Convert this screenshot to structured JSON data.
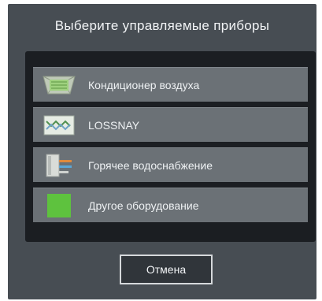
{
  "dialog": {
    "title": "Выберите управляемые приборы",
    "items": [
      {
        "label": "Кондиционер воздуха",
        "icon": "air-conditioner-icon"
      },
      {
        "label": "LOSSNAY",
        "icon": "lossnay-ventilation-icon"
      },
      {
        "label": "Горячее водоснабжение",
        "icon": "hot-water-supply-icon"
      },
      {
        "label": "Другое оборудование",
        "icon": "other-equipment-icon"
      }
    ],
    "cancel_label": "Отмена"
  },
  "colors": {
    "dialog_bg": "#474d53",
    "panel_bg": "#1b1e22",
    "item_bg": "#6b7176",
    "other_equipment_green": "#5ec23e"
  }
}
